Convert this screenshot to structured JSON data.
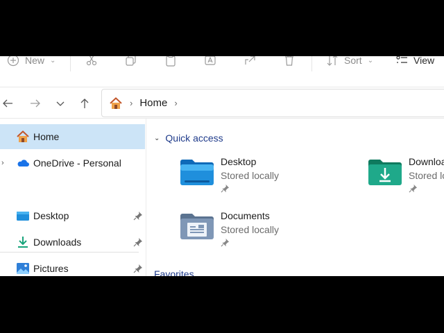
{
  "toolbar": {
    "new_label": "New",
    "sort_label": "Sort",
    "view_label": "View",
    "icons": [
      "new-icon",
      "cut-icon",
      "copy-icon",
      "paste-icon",
      "rename-icon",
      "share-icon",
      "delete-icon",
      "sort-icon",
      "view-icon"
    ]
  },
  "address": {
    "crumbs": [
      "Home"
    ]
  },
  "sidebar": {
    "items": [
      {
        "label": "Home",
        "icon": "home-icon",
        "selected": true
      },
      {
        "label": "OneDrive - Personal",
        "icon": "onedrive-icon"
      },
      {
        "label": "Desktop",
        "icon": "desktop-folder-icon",
        "pinned": true
      },
      {
        "label": "Downloads",
        "icon": "downloads-icon",
        "pinned": true
      },
      {
        "label": "Pictures",
        "icon": "pictures-icon",
        "pinned": true
      }
    ]
  },
  "main": {
    "quick_access_label": "Quick access",
    "favorites_label": "Favorites",
    "tiles": [
      {
        "name": "Desktop",
        "sub": "Stored locally",
        "icon": "desktop-folder-icon"
      },
      {
        "name": "Downloads",
        "sub": "Stored locally",
        "icon": "downloads-folder-icon"
      },
      {
        "name": "Documents",
        "sub": "Stored locally",
        "icon": "documents-folder-icon"
      }
    ]
  },
  "colors": {
    "selection": "#cce4f7",
    "section_header": "#1e3a8a",
    "desktop_folder": "#1f8fdc",
    "downloads_folder": "#1fa98a",
    "documents_folder": "#7f97b6"
  }
}
